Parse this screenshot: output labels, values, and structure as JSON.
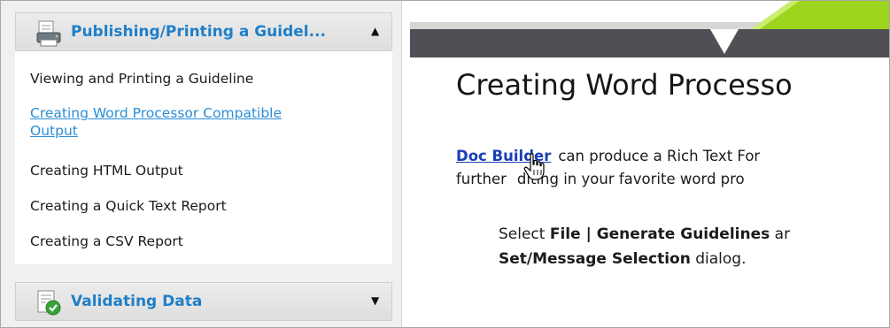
{
  "nav": {
    "section1": {
      "title": "Publishing/Printing a Guidel...",
      "icon": "printer-icon",
      "chevron": "chevron-up-icon",
      "topics": [
        {
          "label": "Viewing and Printing a Guideline",
          "active": false
        },
        {
          "label_line1": "Creating Word Processor Compatible",
          "label_line2": "Output",
          "active": true
        },
        {
          "label": "Creating HTML Output",
          "active": false
        },
        {
          "label": "Creating a Quick Text Report",
          "active": false
        },
        {
          "label": "Creating a CSV Report",
          "active": false
        }
      ]
    },
    "section2": {
      "title": "Validating Data",
      "icon": "document-check-icon",
      "chevron": "chevron-down-icon"
    }
  },
  "content": {
    "heading": "Creating Word Processo",
    "para_link": "Doc Builder",
    "para_line1_rest": "can produce a Rich Text For",
    "para_line2_a": "further",
    "para_line2_b": "diting in your favorite word pro",
    "step_line1_a": "Select ",
    "step_line1_bold": "File | Generate Guidelines",
    "step_line1_b": " ar",
    "step_line2_bold": "Set/Message Selection",
    "step_line2_b": " dialog."
  },
  "colors": {
    "link_active": "#2a8ed6",
    "header_title": "#1f7fc8",
    "doc_link": "#1a3db8",
    "banner_dark": "#4f4f55",
    "banner_green": "#9cd41e"
  }
}
